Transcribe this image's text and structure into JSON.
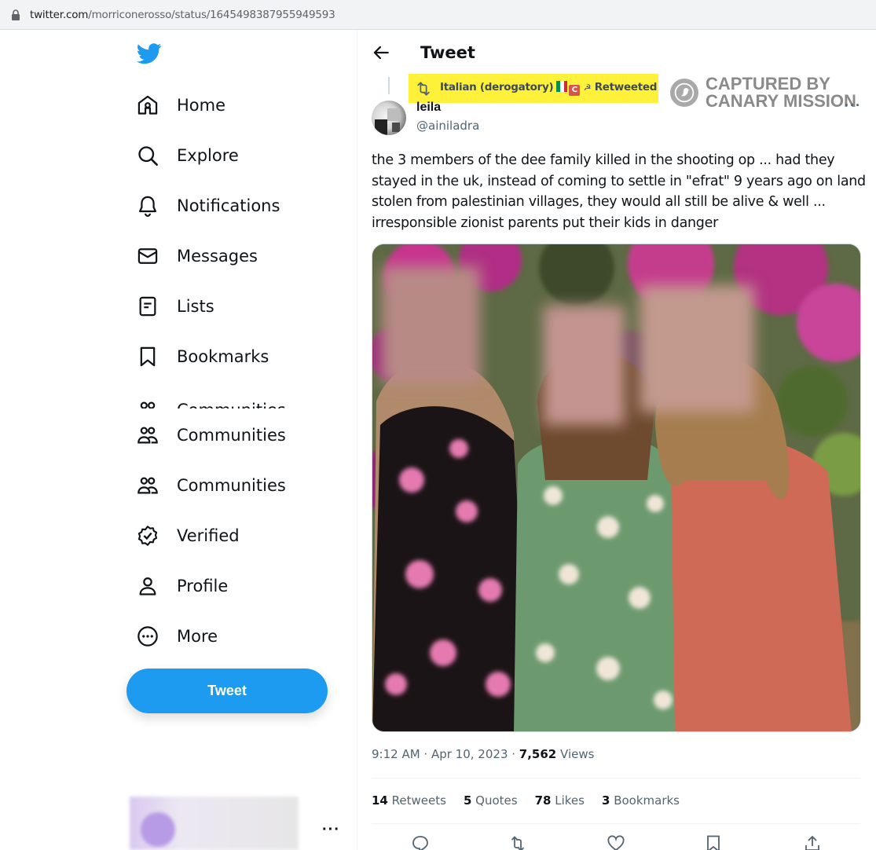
{
  "browser": {
    "url_host": "twitter.com",
    "url_path": "/morriconerosso/status/1645498387955949593"
  },
  "nav": {
    "items": [
      {
        "label": "Home",
        "icon": "home-icon"
      },
      {
        "label": "Explore",
        "icon": "search-icon"
      },
      {
        "label": "Notifications",
        "icon": "bell-icon"
      },
      {
        "label": "Messages",
        "icon": "envelope-icon"
      },
      {
        "label": "Lists",
        "icon": "list-icon"
      },
      {
        "label": "Bookmarks",
        "icon": "bookmark-icon"
      },
      {
        "label": "Communities",
        "icon": "communities-icon"
      },
      {
        "label": "Communities",
        "icon": "communities-icon"
      },
      {
        "label": "Communities",
        "icon": "communities-icon"
      },
      {
        "label": "Verified",
        "icon": "verified-icon"
      },
      {
        "label": "Profile",
        "icon": "person-icon"
      },
      {
        "label": "More",
        "icon": "more-circle-icon"
      }
    ],
    "tweet_button": "Tweet",
    "account_more": "···"
  },
  "header": {
    "title": "Tweet"
  },
  "retweet_banner": {
    "text": "Italian (derogatory)",
    "suffix": "Retweeted"
  },
  "watermark": {
    "line1": "CAPTURED BY",
    "line2": "CANARY MISSION"
  },
  "tweet": {
    "name": "leila",
    "handle": "@ainiladra",
    "more": "···",
    "text": "the 3 members of the dee family killed in the shooting op ... had they stayed in the uk, instead of coming to settle in \"efrat\" 9 years ago on land stolen from palestinian villages, they would all still be alive & well ... irresponsible zionist parents put their kids in danger",
    "time": "9:12 AM",
    "date": "Apr 10, 2023",
    "views_count": "7,562",
    "views_label": "Views"
  },
  "stats": {
    "retweets_count": "14",
    "retweets_label": "Retweets",
    "quotes_count": "5",
    "quotes_label": "Quotes",
    "likes_count": "78",
    "likes_label": "Likes",
    "bookmarks_count": "3",
    "bookmarks_label": "Bookmarks"
  },
  "colors": {
    "accent": "#1d9bf0",
    "highlight": "#fff03a",
    "text": "#0f1419",
    "muted": "#536471"
  }
}
